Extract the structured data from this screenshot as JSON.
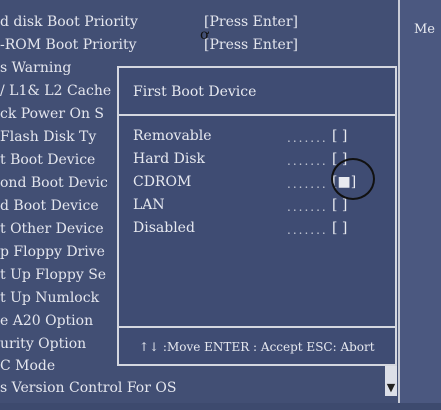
{
  "background_menu": {
    "items": [
      "d disk Boot Priority",
      "-ROM Boot Priority",
      "s Warning",
      "/ L1& L2 Cache",
      "ck Power On S",
      "Flash Disk Ty",
      "t Boot Device",
      "ond Boot Devic",
      "d Boot Device",
      "t Other Device",
      "p Floppy Drive",
      "t Up Floppy Se",
      "t Up Numlock",
      "e A20 Option",
      "urity Option",
      "C Mode",
      "s Version Control For OS"
    ],
    "values": [
      "[Press Enter]",
      "[Press Enter]"
    ]
  },
  "help_panel": {
    "label": "Me"
  },
  "popup": {
    "title": "First Boot Device",
    "options": [
      {
        "label": "Removable",
        "dots": ".......",
        "radio": "[ ]"
      },
      {
        "label": "Hard Disk",
        "dots": ".......",
        "radio": "[ ]"
      },
      {
        "label": "CDROM",
        "dots": ".......",
        "radio": "[■]"
      },
      {
        "label": "LAN",
        "dots": ".......",
        "radio": "[ ]"
      },
      {
        "label": "Disabled",
        "dots": ".......",
        "radio": "[ ]"
      }
    ],
    "selected": "CDROM",
    "footer": "↑↓ :Move ENTER : Accept  ESC: Abort"
  },
  "scroll_arrow": "▼",
  "colors": {
    "background": "#424f74",
    "border": "#d4d7e0",
    "text": "#e6e8ef"
  }
}
